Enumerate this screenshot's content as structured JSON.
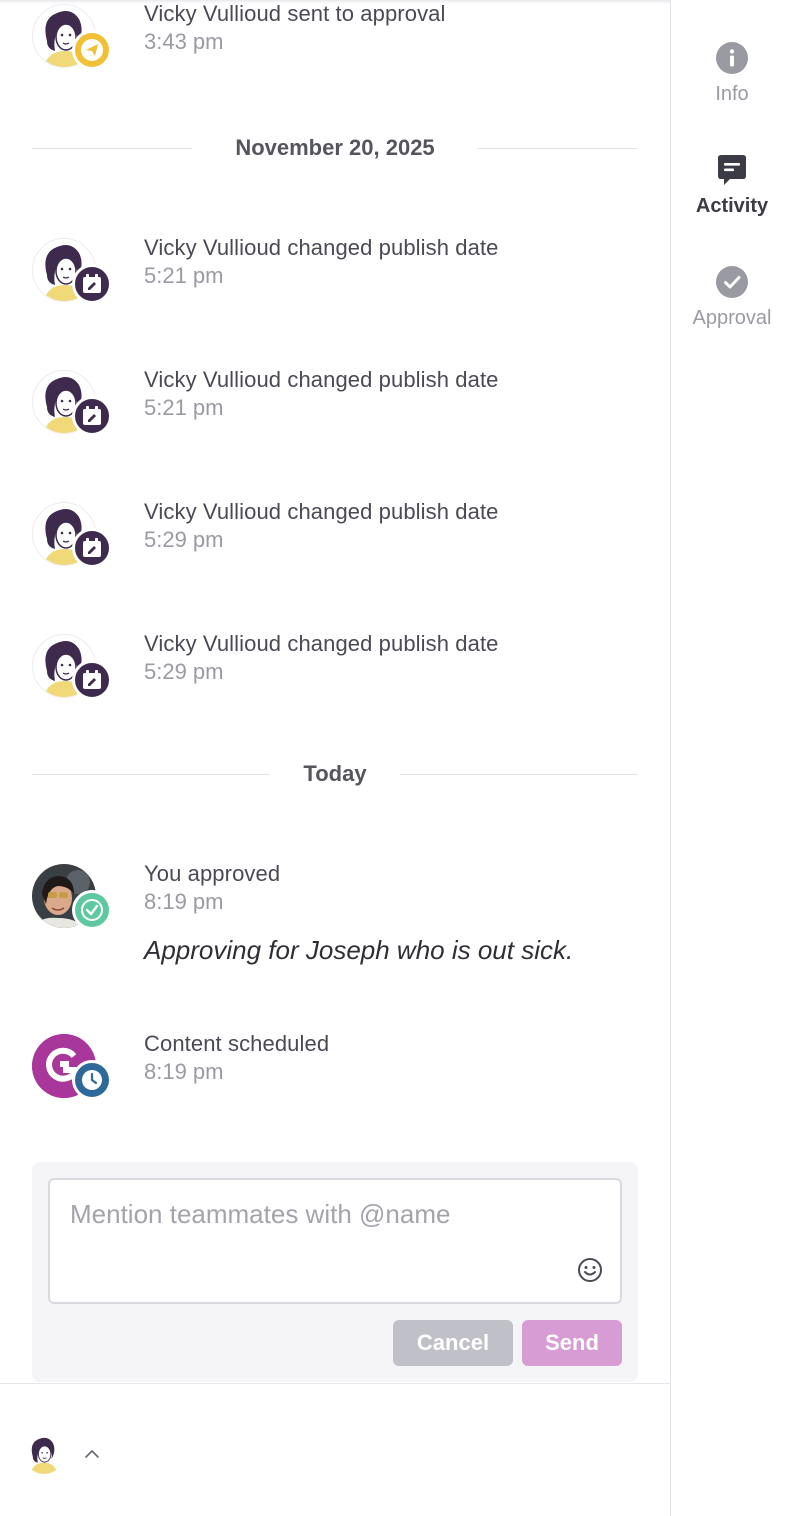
{
  "activity": {
    "first": {
      "title": "Vicky Vullioud sent to approval",
      "time": "3:43 pm",
      "badge": "send-icon",
      "badge_color": "#f2c037"
    },
    "dividers": [
      "November 20, 2025",
      "Today"
    ],
    "changes": [
      {
        "title": "Vicky Vullioud changed publish date",
        "time": "5:21 pm",
        "badge": "calendar-edit-icon"
      },
      {
        "title": "Vicky Vullioud changed publish date",
        "time": "5:21 pm",
        "badge": "calendar-edit-icon"
      },
      {
        "title": "Vicky Vullioud changed publish date",
        "time": "5:29 pm",
        "badge": "calendar-edit-icon"
      },
      {
        "title": "Vicky Vullioud changed publish date",
        "time": "5:29 pm",
        "badge": "calendar-edit-icon"
      }
    ],
    "approved": {
      "title": "You approved",
      "time": "8:19 pm",
      "comment": "Approving for Joseph who is out sick.",
      "badge": "check-icon",
      "badge_color": "#5ec9a1"
    },
    "scheduled": {
      "title": "Content scheduled",
      "time": "8:19 pm",
      "badge": "clock-icon",
      "badge_color": "#2e6a99",
      "logo_color": "#a8369b"
    }
  },
  "composer": {
    "placeholder": "Mention teammates with @name",
    "cancel_label": "Cancel",
    "send_label": "Send"
  },
  "sidebar": {
    "tabs": [
      {
        "label": "Info",
        "icon": "info-icon"
      },
      {
        "label": "Activity",
        "icon": "chat-icon",
        "active": true
      },
      {
        "label": "Approval",
        "icon": "check-circle-icon"
      }
    ]
  },
  "colors": {
    "calendar_badge": "#3d2a4d",
    "send_disabled": "#d79cd4",
    "cancel_disabled": "#c0c0c8"
  }
}
